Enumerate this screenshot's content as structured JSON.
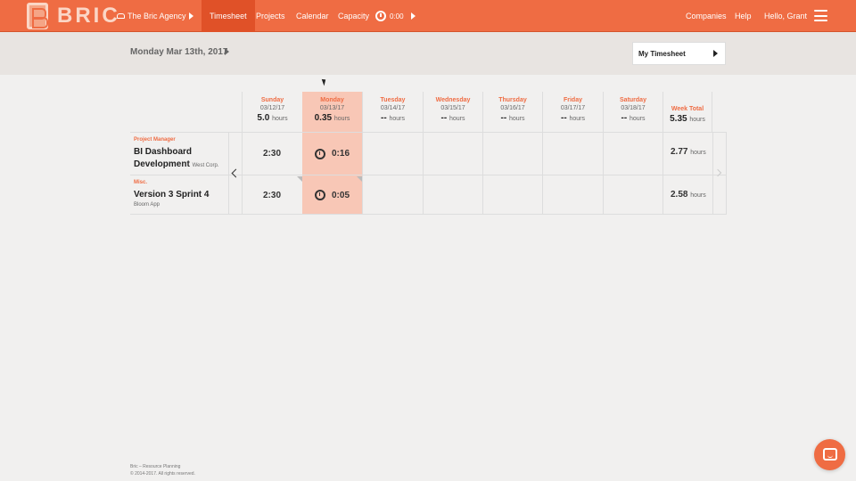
{
  "nav": {
    "logo_text": "BRIC",
    "agency": "The Bric Agency",
    "tabs": [
      "Timesheet",
      "Projects",
      "Calendar",
      "Capacity"
    ],
    "timer": "0:00",
    "right": [
      "Companies",
      "Help",
      "Hello, Grant"
    ]
  },
  "datebar": {
    "date": "Monday Mar 13th, 2017",
    "my_timesheet": "My Timesheet"
  },
  "days": [
    {
      "name": "Sunday",
      "date": "03/12/17",
      "hours": "5.0",
      "unit": "hours"
    },
    {
      "name": "Monday",
      "date": "03/13/17",
      "hours": "0.35",
      "unit": "hours"
    },
    {
      "name": "Tuesday",
      "date": "03/14/17",
      "hours": "--",
      "unit": "hours"
    },
    {
      "name": "Wednesday",
      "date": "03/15/17",
      "hours": "--",
      "unit": "hours"
    },
    {
      "name": "Thursday",
      "date": "03/16/17",
      "hours": "--",
      "unit": "hours"
    },
    {
      "name": "Friday",
      "date": "03/17/17",
      "hours": "--",
      "unit": "hours"
    },
    {
      "name": "Saturday",
      "date": "03/18/17",
      "hours": "--",
      "unit": "hours"
    }
  ],
  "week_total": {
    "label": "Week Total",
    "hours": "5.35",
    "unit": "hours"
  },
  "rows": [
    {
      "role": "Project Manager",
      "name": "BI Dashboard Development",
      "client": "West Corp.",
      "sunday": "2:30",
      "monday": "0:16",
      "total": "2.77",
      "unit": "hours"
    },
    {
      "role": "Misc.",
      "name": "Version 3 Sprint 4",
      "client": "Bloom App",
      "sunday": "2:30",
      "monday": "0:05",
      "total": "2.58",
      "unit": "hours"
    }
  ],
  "footer": {
    "line1": "Bric – Resource Planning",
    "line2": "© 2014-2017. All rights reserved."
  },
  "colors": {
    "accent": "#ef6c43",
    "today": "#f8c7b6"
  }
}
